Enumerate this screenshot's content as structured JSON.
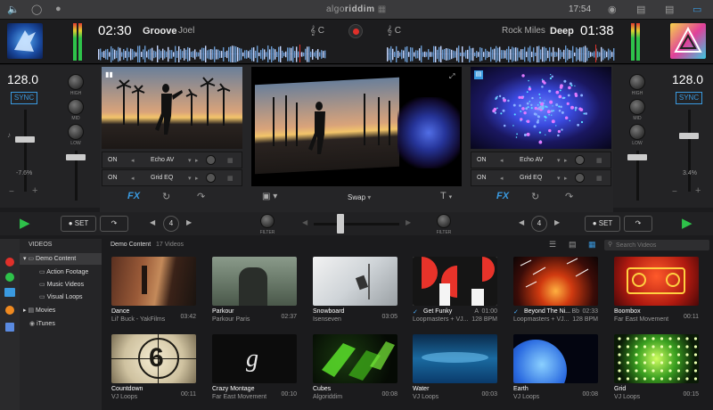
{
  "topbar": {
    "logo_prefix": "algo",
    "logo_suffix": "riddim",
    "clock": "17:54",
    "icons": [
      "volume-icon",
      "headphones-icon",
      "microphone-icon",
      "record-status-icon",
      "layout-icon",
      "split-view-icon",
      "display-icon"
    ]
  },
  "deck_left": {
    "time": "02:30",
    "track": "Groove",
    "artist": "Joel",
    "key": "C",
    "bpm": "128.0",
    "sync": "SYNC",
    "pitch": "-7.6%",
    "knobs": [
      "HIGH",
      "MID",
      "LOW"
    ],
    "fx": [
      {
        "state": "ON",
        "name": "Echo AV"
      },
      {
        "state": "ON",
        "name": "Grid EQ"
      }
    ],
    "fx_label": "FX",
    "cue_label": "SET",
    "loop": "4",
    "filter": "FILTER"
  },
  "deck_right": {
    "time": "01:38",
    "track": "Deep",
    "artist": "Rock Miles",
    "key": "C",
    "bpm": "128.0",
    "sync": "SYNC",
    "pitch": "3.4%",
    "knobs": [
      "HIGH",
      "MID",
      "LOW"
    ],
    "fx": [
      {
        "state": "ON",
        "name": "Echo AV"
      },
      {
        "state": "ON",
        "name": "Grid EQ"
      }
    ],
    "fx_label": "FX",
    "cue_label": "SET",
    "loop": "4",
    "filter": "FILTER"
  },
  "center": {
    "swap_label": "Swap",
    "colors": {
      "accent": "#3a9ae0",
      "play": "#2ec24a",
      "record": "#e0302a"
    }
  },
  "browser": {
    "section": "VIDEOS",
    "tree": [
      {
        "label": "Demo Content",
        "selected": true
      },
      {
        "label": "Action Footage"
      },
      {
        "label": "Music Videos"
      },
      {
        "label": "Visual Loops"
      },
      {
        "label": "Movies"
      },
      {
        "label": "iTunes"
      }
    ],
    "breadcrumb": "Demo Content",
    "count": "17 Videos",
    "search_placeholder": "Search Videos",
    "tiles": [
      {
        "title": "Dance",
        "artist": "Lil' Buck - YakFilms",
        "duration": "03:42"
      },
      {
        "title": "Parkour",
        "artist": "Parkour Paris",
        "duration": "02:37"
      },
      {
        "title": "Snowboard",
        "artist": "Isenseven",
        "duration": "03:05"
      },
      {
        "title": "Get Funky",
        "artist": "Loopmasters + VJ...",
        "key": "A",
        "duration": "01:00",
        "bpm": "128 BPM"
      },
      {
        "title": "Beyond The Ni...",
        "artist": "Loopmasters + VJ...",
        "key": "Bb",
        "duration": "02:33",
        "bpm": "128 BPM"
      },
      {
        "title": "Boombox",
        "artist": "Far East Movement",
        "duration": "00:11"
      },
      {
        "title": "Countdown",
        "artist": "VJ Loops",
        "duration": "00:11"
      },
      {
        "title": "Crazy Montage",
        "artist": "Far East Movement",
        "duration": "00:10"
      },
      {
        "title": "Cubes",
        "artist": "Algoriddim",
        "duration": "00:08"
      },
      {
        "title": "Water",
        "artist": "VJ Loops",
        "duration": "00:03"
      },
      {
        "title": "Earth",
        "artist": "VJ Loops",
        "duration": "00:08"
      },
      {
        "title": "Grid",
        "artist": "VJ Loops",
        "duration": "00:15"
      }
    ]
  }
}
